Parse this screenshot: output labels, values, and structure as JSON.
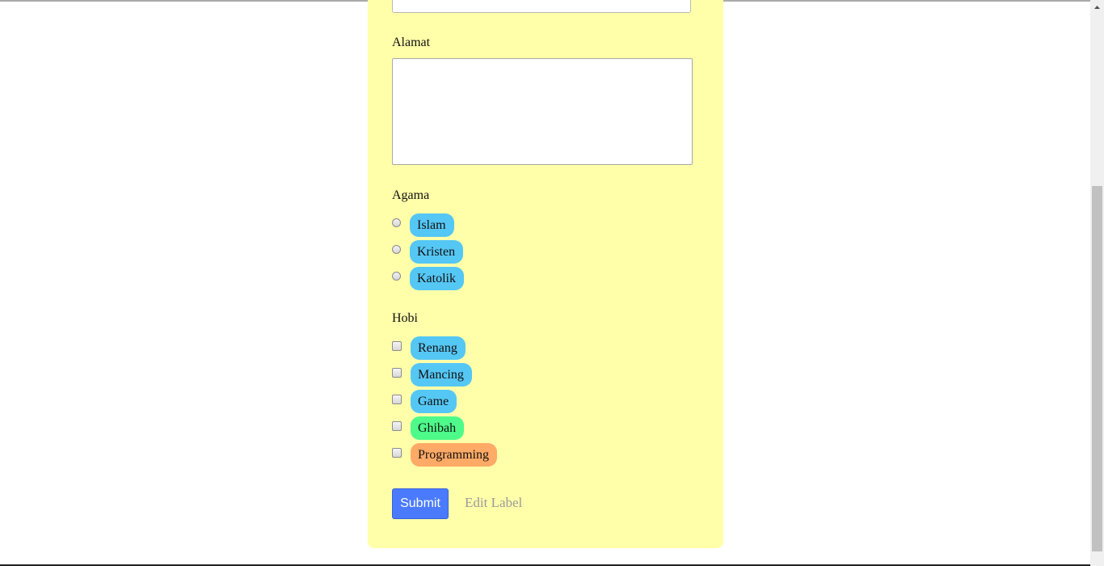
{
  "form": {
    "alamat": {
      "label": "Alamat",
      "value": ""
    },
    "agama": {
      "label": "Agama",
      "options": [
        {
          "label": "Islam",
          "color": "#55c7f5",
          "checked": false
        },
        {
          "label": "Kristen",
          "color": "#55c7f5",
          "checked": false
        },
        {
          "label": "Katolik",
          "color": "#55c7f5",
          "checked": false
        }
      ]
    },
    "hobi": {
      "label": "Hobi",
      "options": [
        {
          "label": "Renang",
          "color": "#55c7f5",
          "checked": false
        },
        {
          "label": "Mancing",
          "color": "#55c7f5",
          "checked": false
        },
        {
          "label": "Game",
          "color": "#55c7f5",
          "checked": false
        },
        {
          "label": "Ghibah",
          "color": "#4dfa8a",
          "checked": false
        },
        {
          "label": "Programming",
          "color": "#ffaa66",
          "checked": false
        }
      ]
    },
    "submit_label": "Submit",
    "edit_label": "Edit Label"
  },
  "colors": {
    "card_background": "#ffffaa",
    "submit_button": "#4a7bff",
    "edit_label_text": "#9a9a9a"
  }
}
